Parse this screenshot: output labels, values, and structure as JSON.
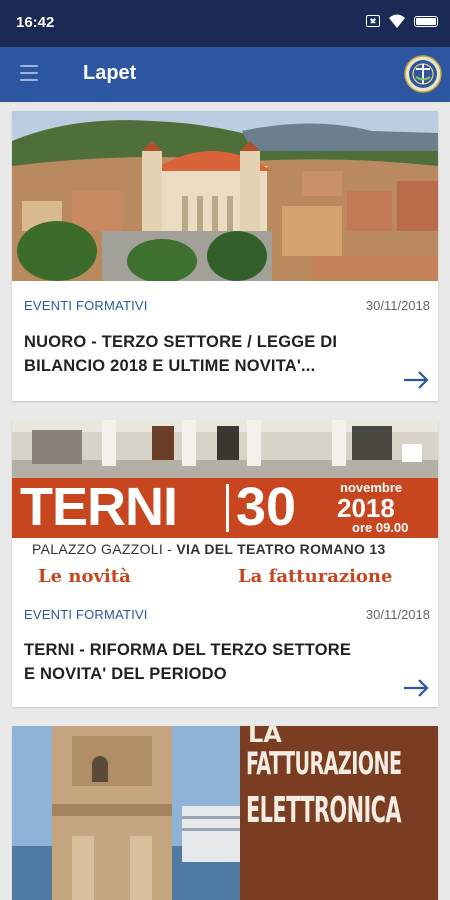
{
  "status_bar": {
    "time": "16:42"
  },
  "app_bar": {
    "title": "Lapet"
  },
  "posters": {
    "terni_word": "TERNI",
    "terni_day": "30",
    "terni_month": "novembre",
    "terni_year": "2018",
    "terni_time": "ore 09.00",
    "terni_place": "PALAZZO GAZZOLI",
    "terni_address": "VIA DEL TEATRO ROMANO 13",
    "terni_novita": "Le novità",
    "terni_fatturazione": "La fatturazione",
    "banner_line1": "LA",
    "banner_line2": "FATTURAZIONE",
    "banner_line3": "ELETTRONICA"
  },
  "cards": [
    {
      "category": "EVENTI FORMATIVI",
      "date": "30/11/2018",
      "title_line1": "NUORO - TERZO SETTORE / LEGGE DI",
      "title_line2": "BILANCIO 2018 E ULTIME NOVITA'..."
    },
    {
      "category": "EVENTI FORMATIVI",
      "date": "30/11/2018",
      "title_line1": "TERNI - RIFORMA DEL TERZO SETTORE",
      "title_line2": "E NOVITA' DEL PERIODO"
    }
  ],
  "colors": {
    "status_bar": "#1b2a55",
    "app_bar": "#2c57a0",
    "accent": "#2c57a0",
    "poster_orange": "#c8461f",
    "banner_brown": "#7a3d22"
  }
}
